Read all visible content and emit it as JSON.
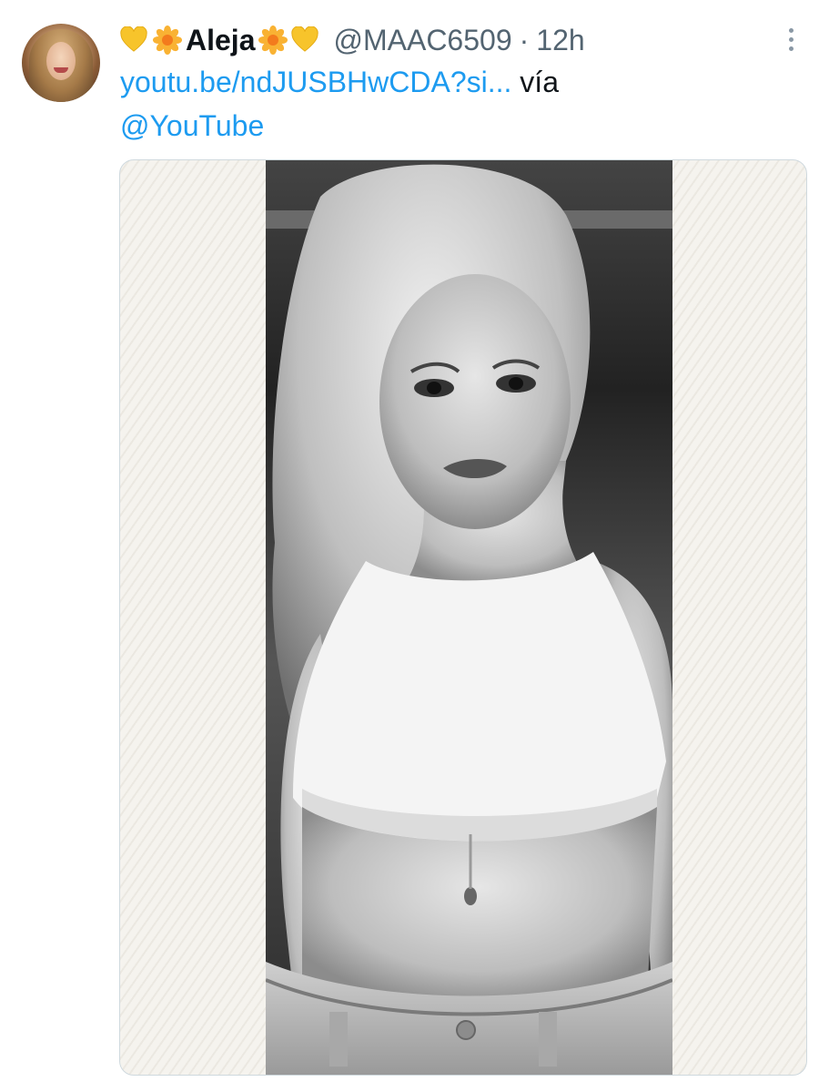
{
  "tweet": {
    "author": {
      "display_name": "Aleja",
      "name_emoji_prefix": [
        "yellow-heart",
        "blossom"
      ],
      "name_emoji_suffix": [
        "blossom",
        "yellow-heart"
      ],
      "handle": "@MAAC6509",
      "separator": "·",
      "time": "12h",
      "avatar_icon": "profile-photo-avatar"
    },
    "more_icon": "more-vertical-icon",
    "text": {
      "link": "youtu.be/ndJUSBHwCDA?si...",
      "via": "vía",
      "mention": "@YouTube"
    },
    "media": {
      "type": "photo",
      "style": "black-and-white portrait"
    }
  },
  "colors": {
    "link": "#1d9bf0",
    "text_primary": "#0f1419",
    "text_secondary": "#536471",
    "media_border": "#cfd9de",
    "media_pattern": "#f3f1ec"
  }
}
